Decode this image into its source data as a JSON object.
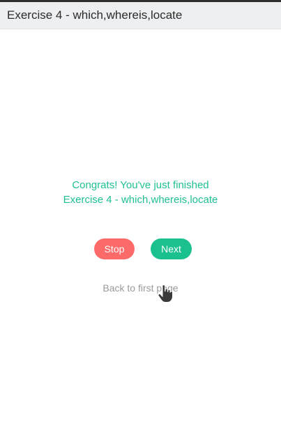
{
  "window": {
    "title": "Exercise 4 - which,whereis,locate"
  },
  "completion": {
    "line1": "Congrats! You've just finished",
    "line2": "Exercise 4 - which,whereis,locate"
  },
  "buttons": {
    "stop_label": "Stop",
    "next_label": "Next"
  },
  "links": {
    "back_label": "Back to first page"
  },
  "icons": {
    "cursor": "hand-pointer-icon"
  },
  "colors": {
    "accent": "#1bc08f",
    "message": "#1fbf94",
    "stop": "#fd6a6a",
    "link": "#9a9a9a"
  }
}
